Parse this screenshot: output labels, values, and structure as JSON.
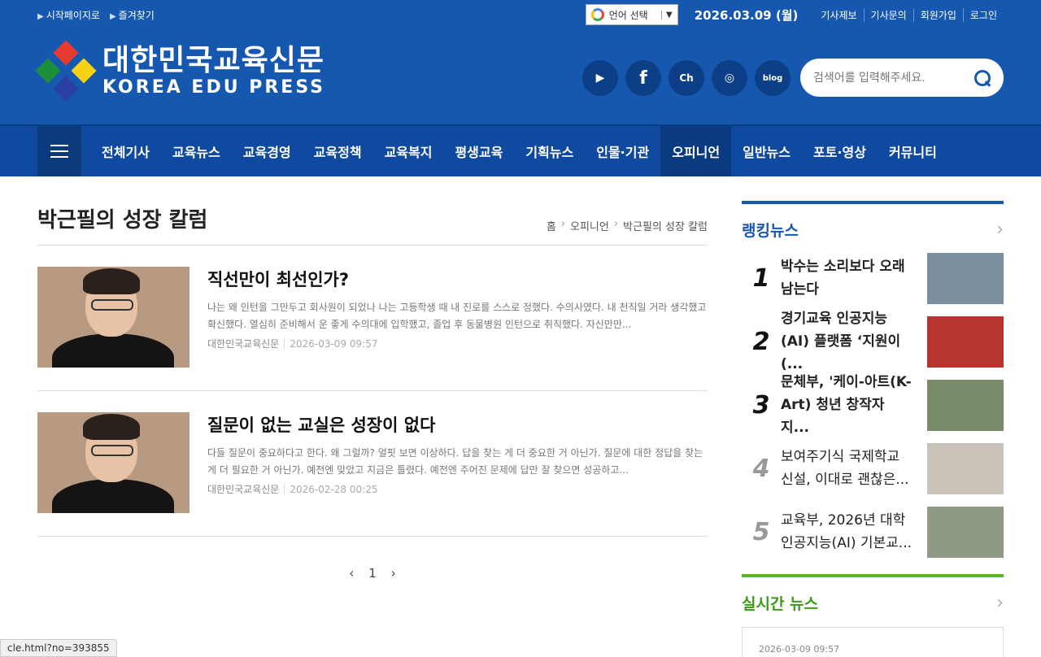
{
  "top": {
    "links": [
      "시작페이지로",
      "즐겨찾기"
    ],
    "lang_label": "언어 선택",
    "date": "2026.03.09 (월)",
    "account": [
      "기사제보",
      "기사문의",
      "회원가입",
      "로그인"
    ]
  },
  "logo": {
    "ko": "대한민국교육신문",
    "en": "KOREA EDU PRESS"
  },
  "social": [
    "youtube",
    "facebook",
    "kakao-channel",
    "instagram",
    "blog"
  ],
  "search": {
    "placeholder": "검색어를 입력해주세요."
  },
  "nav": {
    "items": [
      "전체기사",
      "교육뉴스",
      "교육경영",
      "교육정책",
      "교육복지",
      "평생교육",
      "기획뉴스",
      "인물·기관",
      "오피니언",
      "일반뉴스",
      "포토·영상",
      "커뮤니티"
    ],
    "active": "오피니언"
  },
  "page": {
    "title": "박근필의 성장 칼럼",
    "breadcrumb": [
      "홈",
      "오피니언",
      "박근필의 성장 칼럼"
    ]
  },
  "articles": [
    {
      "title": "직선만이 최선인가?",
      "summary": "나는 왜 인턴을 그만두고 회사원이 되었나 나는 고등학생 때 내 진로를 스스로 정했다. 수의사였다. 내 천직일 거라 생각했고 확신했다. 열심히 준비해서 운 좋게 수의대에 입학했고, 졸업 후 동물병원 인턴으로 취직했다. 자신만만...",
      "author": "대한민국교육신문",
      "date": "2026-03-09 09:57"
    },
    {
      "title": "질문이 없는 교실은 성장이 없다",
      "summary": "다들 질문이 중요하다고 한다. 왜 그럴까? 얼핏 보면 이상하다. 답을 찾는 게 더 중요한 거 아닌가. 질문에 대한 정답을 찾는 게 더 필요한 거 아닌가. 예전엔 맞았고 지금은 틀렸다. 예전엔 주어진 문제에 답만 잘 찾으면 성공하고...",
      "author": "대한민국교육신문",
      "date": "2026-02-28 00:25"
    }
  ],
  "pager": {
    "prev": "‹",
    "current": "1",
    "next": "›"
  },
  "ranking": {
    "title": "랭킹뉴스",
    "items": [
      {
        "num": "1",
        "title": "박수는 소리보다 오래 남는다"
      },
      {
        "num": "2",
        "title": "경기교육 인공지능(AI) 플랫폼 ‘지원이(..."
      },
      {
        "num": "3",
        "title": "문체부, '케이-아트(K-Art) 청년 창작자 지..."
      },
      {
        "num": "4",
        "title": "보여주기식 국제학교 신설, 이대로 괜찮은..."
      },
      {
        "num": "5",
        "title": "교육부, 2026년 대학 인공지능(AI) 기본교..."
      }
    ]
  },
  "live": {
    "title": "실시간 뉴스",
    "first_date": "2026-03-09 09:57"
  },
  "status_url": "cle.html?no=393855"
}
